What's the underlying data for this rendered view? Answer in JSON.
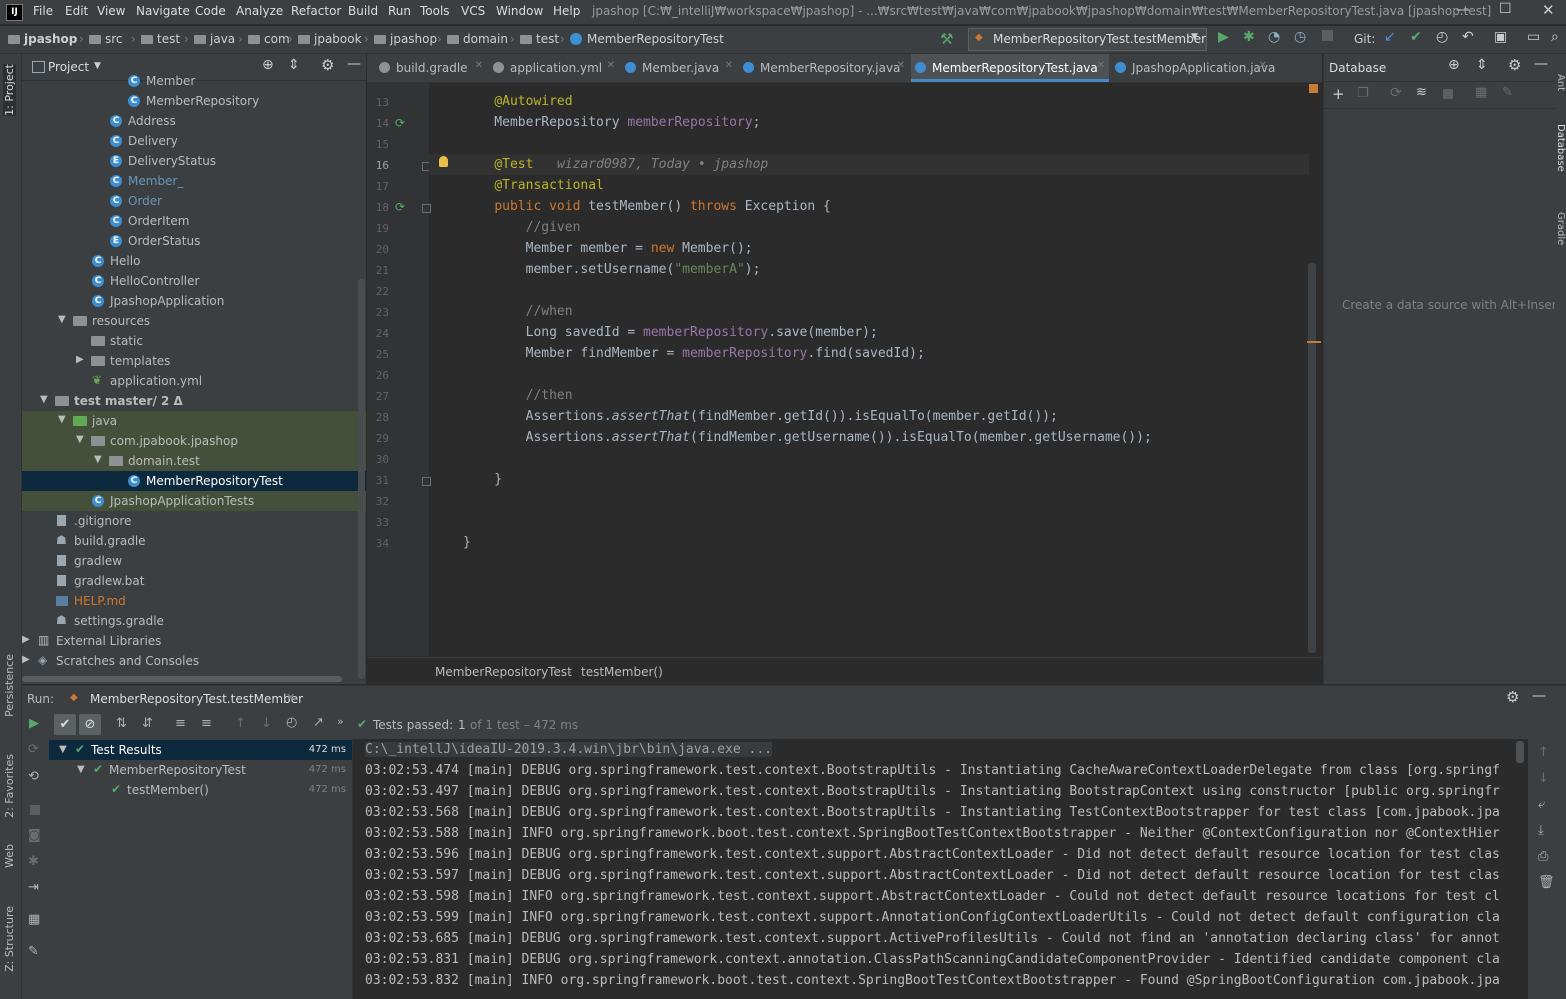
{
  "menu": [
    "File",
    "Edit",
    "View",
    "Navigate",
    "Code",
    "Analyze",
    "Refactor",
    "Build",
    "Run",
    "Tools",
    "VCS",
    "Window",
    "Help"
  ],
  "window_title": "jpashop [C:₩_intelliJ₩workspace₩jpashop] - ...₩src₩test₩java₩com₩jpabook₩jpashop₩domain₩test₩MemberRepositoryTest.java [jpashop.test]",
  "breadcrumbs": [
    "jpashop",
    "src",
    "test",
    "java",
    "com",
    "jpabook",
    "jpashop",
    "domain",
    "test",
    "MemberRepositoryTest"
  ],
  "run_config": "MemberRepositoryTest.testMember",
  "git_label": "Git:",
  "project": {
    "title": "Project",
    "tree": [
      {
        "label": "Member",
        "indent": 4,
        "icon": "class",
        "color": "#bbbbbb"
      },
      {
        "label": "MemberRepository",
        "indent": 4,
        "icon": "class",
        "color": "#bbbbbb"
      },
      {
        "label": "Address",
        "indent": 3,
        "icon": "class",
        "color": "#bbbbbb"
      },
      {
        "label": "Delivery",
        "indent": 3,
        "icon": "class",
        "color": "#bbbbbb"
      },
      {
        "label": "DeliveryStatus",
        "indent": 3,
        "icon": "enum",
        "color": "#bbbbbb"
      },
      {
        "label": "Member_",
        "indent": 3,
        "icon": "class",
        "color": "#6897bb"
      },
      {
        "label": "Order",
        "indent": 3,
        "icon": "class",
        "color": "#6897bb"
      },
      {
        "label": "OrderItem",
        "indent": 3,
        "icon": "class",
        "color": "#bbbbbb"
      },
      {
        "label": "OrderStatus",
        "indent": 3,
        "icon": "enum",
        "color": "#bbbbbb"
      },
      {
        "label": "Hello",
        "indent": 2,
        "icon": "class",
        "color": "#bbbbbb"
      },
      {
        "label": "HelloController",
        "indent": 2,
        "icon": "class",
        "color": "#bbbbbb"
      },
      {
        "label": "JpashopApplication",
        "indent": 2,
        "icon": "class",
        "color": "#bbbbbb"
      },
      {
        "label": "resources",
        "indent": 1,
        "icon": "folder",
        "arrow": "down",
        "color": "#bbbbbb"
      },
      {
        "label": "static",
        "indent": 2,
        "icon": "folder",
        "color": "#bbbbbb"
      },
      {
        "label": "templates",
        "indent": 2,
        "icon": "folder",
        "arrow": "right",
        "color": "#bbbbbb"
      },
      {
        "label": "application.yml",
        "indent": 2,
        "icon": "yml",
        "color": "#bbbbbb"
      },
      {
        "label": "test  master/ 2 Δ",
        "indent": 0,
        "icon": "folder",
        "arrow": "down",
        "color": "#bbbbbb",
        "bold": true
      },
      {
        "label": "java",
        "indent": 1,
        "icon": "folder-green",
        "arrow": "down",
        "color": "#bbbbbb",
        "hl": true
      },
      {
        "label": "com.jpabook.jpashop",
        "indent": 2,
        "icon": "folder",
        "arrow": "down",
        "color": "#bbbbbb",
        "hl": true
      },
      {
        "label": "domain.test",
        "indent": 3,
        "icon": "folder",
        "arrow": "down",
        "color": "#bbbbbb",
        "hl": true
      },
      {
        "label": "MemberRepositoryTest",
        "indent": 4,
        "icon": "class",
        "color": "#ffffff",
        "selected": true
      },
      {
        "label": "JpashopApplicationTests",
        "indent": 2,
        "icon": "class",
        "color": "#bbbbbb",
        "hl": true
      },
      {
        "label": ".gitignore",
        "indent": 0,
        "icon": "file",
        "color": "#bbbbbb"
      },
      {
        "label": "build.gradle",
        "indent": 0,
        "icon": "gradle",
        "color": "#bbbbbb"
      },
      {
        "label": "gradlew",
        "indent": 0,
        "icon": "file",
        "color": "#bbbbbb"
      },
      {
        "label": "gradlew.bat",
        "indent": 0,
        "icon": "file",
        "color": "#bbbbbb"
      },
      {
        "label": "HELP.md",
        "indent": 0,
        "icon": "md",
        "color": "#cc7832"
      },
      {
        "label": "settings.gradle",
        "indent": 0,
        "icon": "gradle",
        "color": "#bbbbbb"
      },
      {
        "label": "External Libraries",
        "indent": -1,
        "icon": "lib",
        "arrow": "right",
        "color": "#bbbbbb"
      },
      {
        "label": "Scratches and Consoles",
        "indent": -1,
        "icon": "scratch",
        "arrow": "right",
        "color": "#bbbbbb"
      }
    ]
  },
  "tabs": [
    {
      "label": "build.gradle",
      "active": false
    },
    {
      "label": "application.yml",
      "active": false
    },
    {
      "label": "Member.java",
      "active": false
    },
    {
      "label": "MemberRepository.java",
      "active": false
    },
    {
      "label": "MemberRepositoryTest.java",
      "active": true
    },
    {
      "label": "JpashopApplication.java",
      "active": false
    }
  ],
  "editor": {
    "lines": [
      {
        "n": "13",
        "html": "    <span class='ann'>@Autowired</span>"
      },
      {
        "n": "14",
        "html": "    MemberRepository <span class='fld'>memberRepository</span>;"
      },
      {
        "n": "15",
        "html": ""
      },
      {
        "n": "16",
        "html": "    <span class='ann'>@Test</span>   <span class='cm ital'>wizard0987, Today • jpashop</span>"
      },
      {
        "n": "17",
        "html": "    <span class='ann'>@Transactional</span>"
      },
      {
        "n": "18",
        "html": "    <span class='kw'>public void</span> testMember() <span class='kw'>throws</span> Exception {"
      },
      {
        "n": "19",
        "html": "        <span class='cm'>//given</span>"
      },
      {
        "n": "20",
        "html": "        Member member = <span class='kw'>new</span> Member();"
      },
      {
        "n": "21",
        "html": "        member.setUsername(<span class='str'>\"memberA\"</span>);"
      },
      {
        "n": "22",
        "html": ""
      },
      {
        "n": "23",
        "html": "        <span class='cm'>//when</span>"
      },
      {
        "n": "24",
        "html": "        Long savedId = <span class='fld'>memberRepository</span>.save(member);"
      },
      {
        "n": "25",
        "html": "        Member findMember = <span class='fld'>memberRepository</span>.find(savedId);"
      },
      {
        "n": "26",
        "html": ""
      },
      {
        "n": "27",
        "html": "        <span class='cm'>//then</span>"
      },
      {
        "n": "28",
        "html": "        Assertions.<span class='ital'>assertThat</span>(findMember.getId()).isEqualTo(member.getId());"
      },
      {
        "n": "29",
        "html": "        Assertions.<span class='ital'>assertThat</span>(findMember.getUsername()).isEqualTo(member.getUsername());"
      },
      {
        "n": "30",
        "html": ""
      },
      {
        "n": "31",
        "html": "    }"
      },
      {
        "n": "32",
        "html": ""
      },
      {
        "n": "33",
        "html": ""
      },
      {
        "n": "34",
        "html": "}"
      }
    ],
    "breadcrumb": [
      "MemberRepositoryTest",
      "testMember()"
    ]
  },
  "database": {
    "title": "Database",
    "empty_text": "Create a data source with Alt+Insert"
  },
  "side_labels": {
    "left_top": "1: Project",
    "left_persistence": "Persistence",
    "left_favorites": "2: Favorites",
    "left_web": "Web",
    "left_structure": "Z: Structure",
    "right_database": "Database",
    "right_gradle": "Gradle",
    "right_ant": "Ant"
  },
  "run": {
    "label": "Run:",
    "tab": "MemberRepositoryTest.testMember",
    "status_prefix": "Tests passed:",
    "status_count": "1",
    "status_suffix": "of 1 test – 472 ms",
    "results": [
      {
        "label": "Test Results",
        "time": "472 ms",
        "indent": 0,
        "selected": true
      },
      {
        "label": "MemberRepositoryTest",
        "time": "472 ms",
        "indent": 1
      },
      {
        "label": "testMember()",
        "time": "472 ms",
        "indent": 2
      }
    ],
    "console": [
      "C:\\_intellJ\\ideaIU-2019.3.4.win\\jbr\\bin\\java.exe ...",
      "03:02:53.474 [main] DEBUG org.springframework.test.context.BootstrapUtils - Instantiating CacheAwareContextLoaderDelegate from class [org.springf",
      "03:02:53.497 [main] DEBUG org.springframework.test.context.BootstrapUtils - Instantiating BootstrapContext using constructor [public org.springfr",
      "03:02:53.568 [main] DEBUG org.springframework.test.context.BootstrapUtils - Instantiating TestContextBootstrapper for test class [com.jpabook.jpa",
      "03:02:53.588 [main] INFO org.springframework.boot.test.context.SpringBootTestContextBootstrapper - Neither @ContextConfiguration nor @ContextHier",
      "03:02:53.596 [main] DEBUG org.springframework.test.context.support.AbstractContextLoader - Did not detect default resource location for test clas",
      "03:02:53.597 [main] DEBUG org.springframework.test.context.support.AbstractContextLoader - Did not detect default resource location for test clas",
      "03:02:53.598 [main] INFO org.springframework.test.context.support.AbstractContextLoader - Could not detect default resource locations for test cl",
      "03:02:53.599 [main] INFO org.springframework.test.context.support.AnnotationConfigContextLoaderUtils - Could not detect default configuration cla",
      "03:02:53.685 [main] DEBUG org.springframework.test.context.support.ActiveProfilesUtils - Could not find an 'annotation declaring class' for annot",
      "03:02:53.831 [main] DEBUG org.springframework.context.annotation.ClassPathScanningCandidateComponentProvider - Identified candidate component cla",
      "03:02:53.832 [main] INFO org.springframework.boot.test.context.SpringBootTestContextBootstrapper - Found @SpringBootConfiguration com.jpabook.jpa"
    ]
  }
}
